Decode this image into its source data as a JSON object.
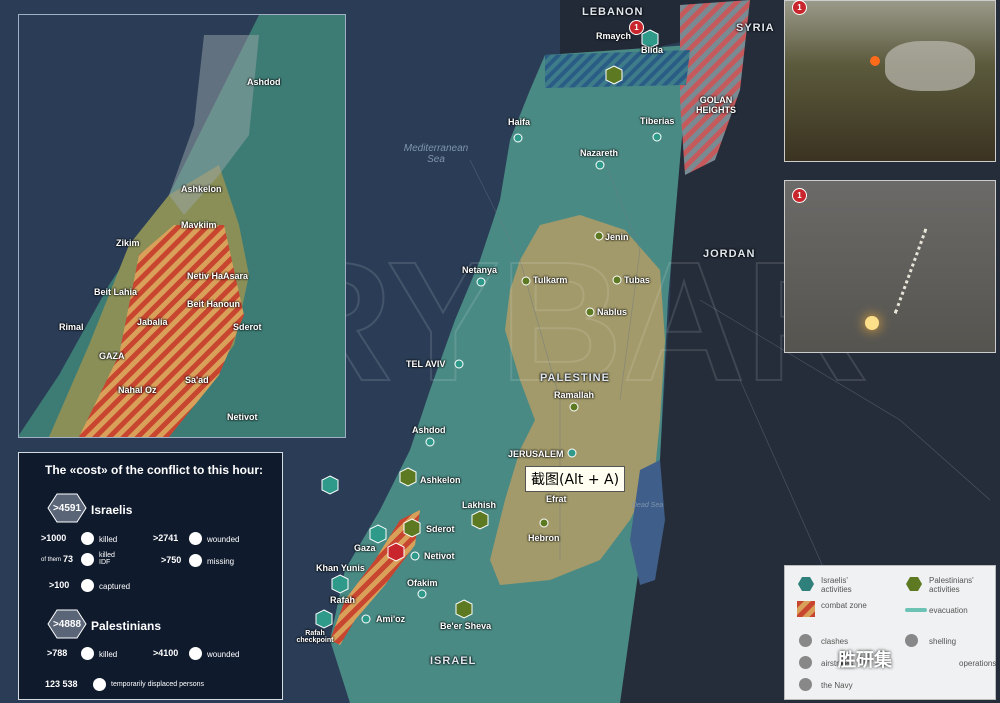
{
  "regions": {
    "lebanon": "LEBANON",
    "syria": "SYRIA",
    "golan": "GOLAN HEIGHTS",
    "jordan": "JORDAN",
    "palestine": "PALESTINE",
    "israel": "ISRAEL",
    "sea": "Mediterranean Sea",
    "dead_sea": "Dead Sea"
  },
  "cities": {
    "rmaych": "Rmaych",
    "blida": "Blida",
    "haifa": "Haifa",
    "tiberias": "Tiberias",
    "nazareth": "Nazareth",
    "jenin": "Jenin",
    "netanya": "Netanya",
    "tulkarm": "Tulkarm",
    "tubas": "Tubas",
    "nablus": "Nablus",
    "tel_aviv": "TEL AVIV",
    "ramallah": "Ramallah",
    "ashdod": "Ashdod",
    "jerusalem": "JERUSALEM",
    "ashkelon": "Ashkelon",
    "efrat": "Efrat",
    "lakhish": "Lakhish",
    "hebron": "Hebron",
    "sderot": "Sderot",
    "gaza": "Gaza",
    "netivot": "Netivot",
    "khan_yunis": "Khan Yunis",
    "ofakim": "Ofakim",
    "rafah": "Rafah",
    "amioz": "Ami'oz",
    "beer_sheva": "Be'er Sheva",
    "rafah_checkpoint": "Rafah checkpoint"
  },
  "inset_labels": {
    "ashdod": "Ashdod",
    "ashkelon": "Ashkelon",
    "mavkiim": "Mavkiim",
    "zikim": "Zikim",
    "netiv": "Netiv HaAsara",
    "beit_lahia": "Beit Lahia",
    "beit_hanoun": "Beit Hanoun",
    "jabalia": "Jabalia",
    "rimal": "Rimal",
    "sderot": "Sderot",
    "gaza": "GAZA",
    "nahal_oz": "Nahal Oz",
    "saad": "Sa'ad",
    "netivot": "Netivot"
  },
  "photo_badges": [
    "1",
    "1"
  ],
  "map_badge": "1",
  "cost": {
    "title": "The «cost» of the conflict to this hour:",
    "israelis": {
      "total": ">4591",
      "label": "Israelis",
      "killed_value": ">1000",
      "killed_label": "killed",
      "of_them": "of them",
      "idf_value": "73",
      "idf_label": "killed IDF",
      "wounded_value": ">2741",
      "wounded_label": "wounded",
      "missing_value": ">750",
      "missing_label": "missing",
      "captured_value": ">100",
      "captured_label": "captured"
    },
    "palestinians": {
      "total": ">4888",
      "label": "Palestinians",
      "killed_value": ">788",
      "killed_label": "killed",
      "wounded_value": ">4100",
      "wounded_label": "wounded"
    },
    "displaced_value": "123 538",
    "displaced_label": "temporarily displaced persons"
  },
  "legend": {
    "israeli_activities": "Israelis' activities",
    "palestinian_activities": "Palestinians' activities",
    "combat_zone": "combat zone",
    "evacuation": "evacuation",
    "clashes": "clashes",
    "shelling": "shelling",
    "airstrikes": "airstrikes",
    "operations": "operations",
    "navy": "the Navy"
  },
  "tooltip": "截图(Alt + A)",
  "watermark": "胜研集",
  "colors": {
    "background": "#1c2535",
    "israel_land": "#4a8a84",
    "palestine_land": "#a69b68",
    "jordan_land": "#2a3240",
    "sea": "#2b3d56",
    "israeli_marker": "#2f9a8a",
    "palestinian_marker": "#5d7a23",
    "combat_orange": "#e9893a",
    "combat_red": "#c8262c"
  }
}
